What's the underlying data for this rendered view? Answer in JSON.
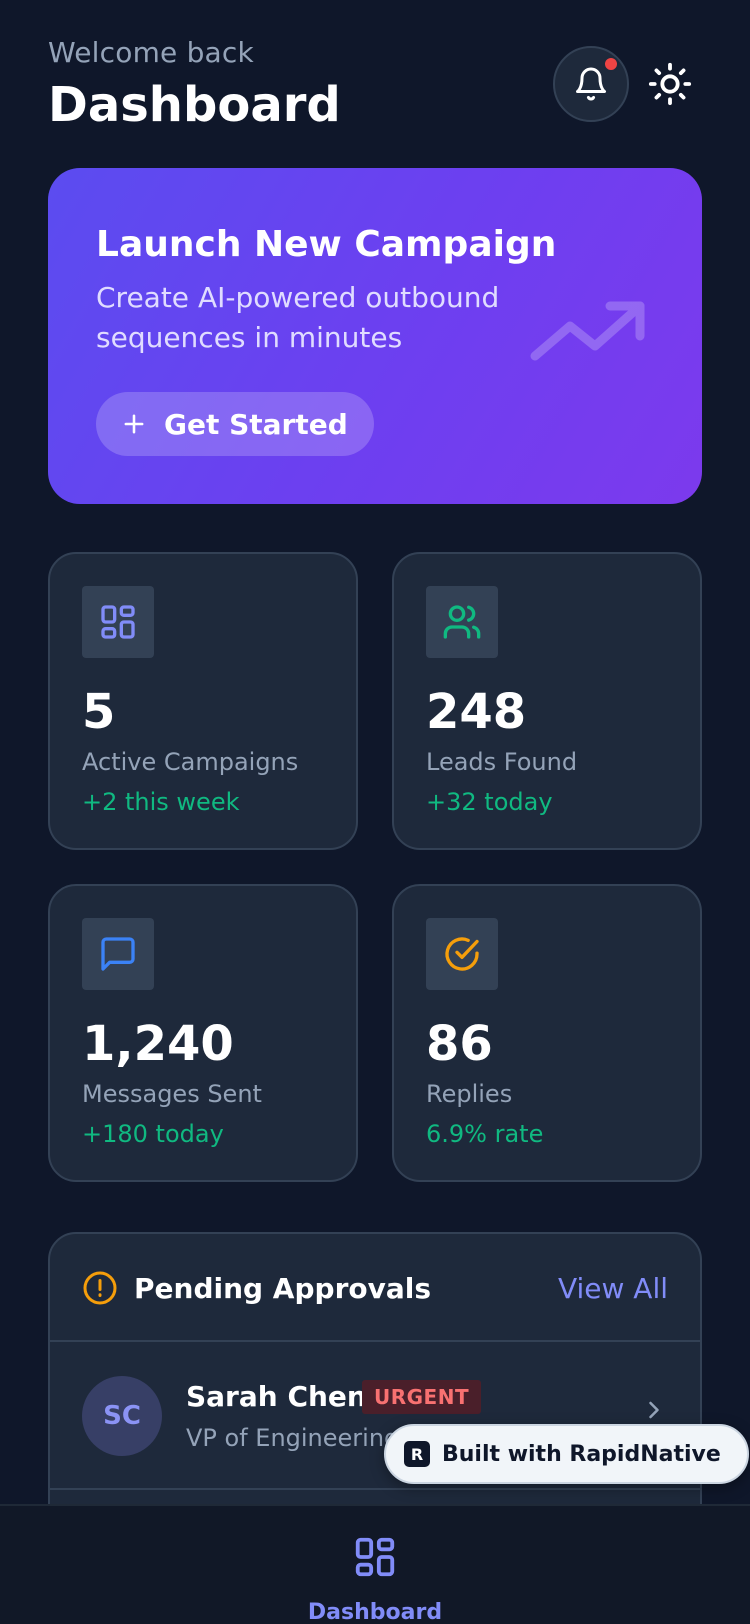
{
  "header": {
    "welcome": "Welcome back",
    "title": "Dashboard",
    "notification_icon": "bell-icon",
    "theme_icon": "sun-icon"
  },
  "hero": {
    "title": "Launch New Campaign",
    "subtitle": "Create AI-powered outbound sequences in minutes",
    "button_label": "Get Started",
    "button_icon": "plus-icon",
    "decoration_icon": "trending-up-icon"
  },
  "stats": [
    {
      "icon": "grid-icon",
      "icon_color": "#818cf8",
      "value": "5",
      "label": "Active Campaigns",
      "delta": "+2 this week"
    },
    {
      "icon": "users-icon",
      "icon_color": "#10b981",
      "value": "248",
      "label": "Leads Found",
      "delta": "+32 today"
    },
    {
      "icon": "message-icon",
      "icon_color": "#3b82f6",
      "value": "1,240",
      "label": "Messages Sent",
      "delta": "+180 today"
    },
    {
      "icon": "check-circle-icon",
      "icon_color": "#f59e0b",
      "value": "86",
      "label": "Replies",
      "delta": "6.9% rate"
    }
  ],
  "pending": {
    "title": "Pending Approvals",
    "view_all": "View All",
    "icon": "alert-circle-icon",
    "items": [
      {
        "initials": "SC",
        "name": "Sarah Chen",
        "badge": "URGENT",
        "role": "VP of Engineering at TechCorp Inc"
      }
    ]
  },
  "badge": {
    "label": "Built with RapidNative",
    "logo": "R"
  },
  "tabbar": {
    "items": [
      {
        "label": "Dashboard",
        "icon": "grid-icon",
        "active": true
      }
    ]
  },
  "colors": {
    "background": "#0f172a",
    "card": "#1e293b",
    "accent": "#818cf8",
    "positive": "#10b981",
    "urgent": "#f87171",
    "notification_dot": "#ef4444"
  }
}
